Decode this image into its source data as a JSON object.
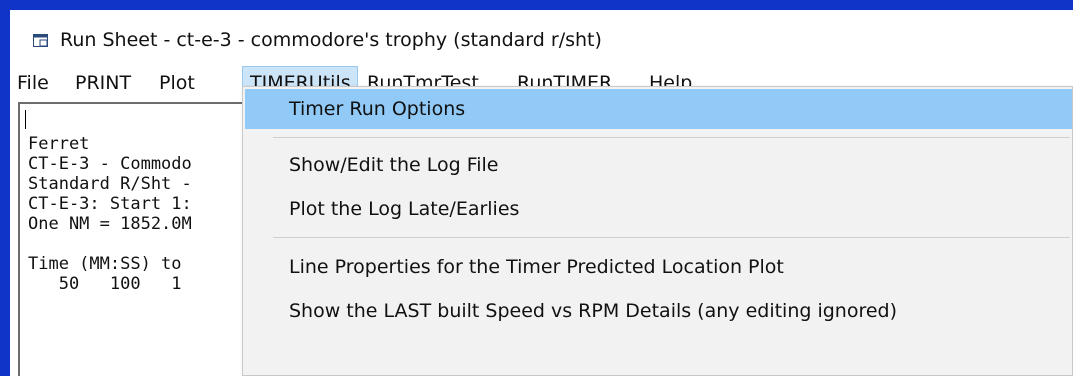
{
  "window": {
    "title": "Run Sheet - ct-e-3 - commodore's trophy (standard r/sht)",
    "icon": "app-window-icon"
  },
  "menubar": {
    "items": [
      {
        "label": "File"
      },
      {
        "label": "PRINT"
      },
      {
        "label": "Plot"
      },
      {
        "label": "TIMERUtils",
        "active": true
      },
      {
        "label": "RunTmrTest"
      },
      {
        "label": "RunTIMER"
      },
      {
        "label": "Help"
      }
    ]
  },
  "text_area": {
    "lines": [
      "Ferret",
      "CT-E-3 - Commodo",
      "Standard R/Sht -",
      "CT-E-3: Start 1:",
      "One NM = 1852.0M",
      "",
      "Time (MM:SS) to ",
      "   50   100   1"
    ]
  },
  "dropdown": {
    "items": [
      {
        "label": "Timer Run Options",
        "highlighted": true
      },
      {
        "label": "Show/Edit the Log File"
      },
      {
        "label": "Plot the Log Late/Earlies"
      },
      {
        "label": "Line Properties for the Timer Predicted Location Plot"
      },
      {
        "label": "Show the LAST built Speed vs RPM Details (any editing ignored)"
      }
    ]
  },
  "colors": {
    "frame_border": "#1033c8",
    "menu_highlight": "#91c9f7",
    "active_menu": "#cce4f7"
  }
}
